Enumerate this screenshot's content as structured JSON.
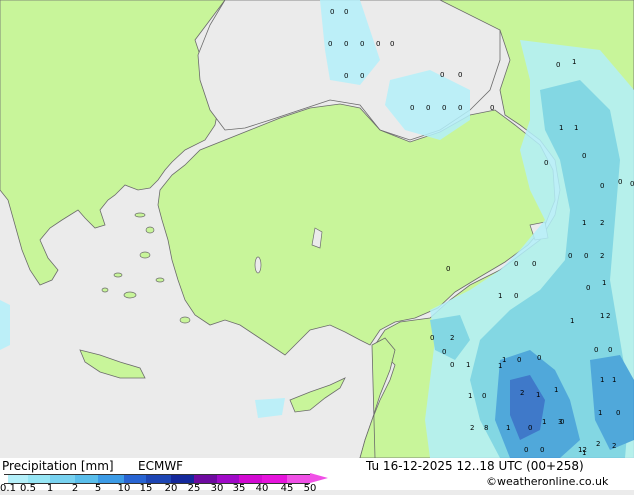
{
  "map": {
    "region_labels": [
      "0",
      "0",
      "0",
      "0",
      "0",
      "0",
      "0",
      "0",
      "0",
      "0",
      "0",
      "0",
      "1",
      "0",
      "0",
      "0",
      "0",
      "0",
      "1",
      "1",
      "0",
      "0",
      "0",
      "0",
      "0",
      "0",
      "0",
      "0",
      "1",
      "2",
      "0",
      "0",
      "2",
      "1",
      "0",
      "1",
      "2",
      "1",
      "0",
      "0",
      "1",
      "1",
      "0",
      "1",
      "1",
      "1",
      "0",
      "0",
      "1",
      "1",
      "2",
      "0",
      "1",
      "8",
      "2",
      "1",
      "0",
      "1",
      "3",
      "1",
      "1",
      "0",
      "2",
      "0",
      "12",
      "2",
      "0",
      "0",
      "1",
      "0",
      "2",
      "0",
      "0"
    ],
    "colors": {
      "land": "#c8f59a",
      "sea": "#ebebeb",
      "coast": "#6b6b6b",
      "precip_light": "#b4f0fa",
      "precip_mid": "#78d2f0",
      "precip_heavy": "#3c9be6",
      "precip_strong": "#2864d2"
    }
  },
  "legend": {
    "title": "Precipitation [mm]",
    "model": "ECMWF",
    "datetime": "Tu 16-12-2025 12..18 UTC (00+258)",
    "credit": "©weatheronline.co.uk",
    "ticks": [
      "0.1",
      "0.5",
      "1",
      "2",
      "5",
      "10",
      "15",
      "20",
      "25",
      "30",
      "35",
      "40",
      "45",
      "50"
    ],
    "colors": [
      "#ffffff",
      "#b4f0fa",
      "#96e6f5",
      "#78d2f0",
      "#5abeeb",
      "#3c9be6",
      "#2864d2",
      "#1e46b4",
      "#14289b",
      "#6e0aa0",
      "#a00ac8",
      "#d20ad2",
      "#e614dc",
      "#f050e6"
    ]
  }
}
